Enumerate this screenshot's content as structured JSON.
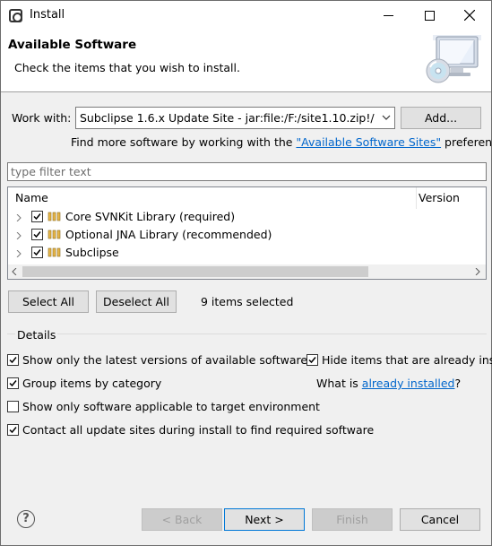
{
  "window": {
    "title": "Install"
  },
  "banner": {
    "title": "Available Software",
    "description": "Check the items that you wish to install."
  },
  "work_with": {
    "label": "Work with:",
    "value": "Subclipse 1.6.x Update Site - jar:file:/F:/site1.10.zip!/",
    "add_label": "Add..."
  },
  "find_more": {
    "prefix": "Find more software by working with the ",
    "link": "\"Available Software Sites\"",
    "suffix": " preferences."
  },
  "filter": {
    "placeholder": "type filter text"
  },
  "tree": {
    "columns": [
      "Name",
      "Version"
    ],
    "items": [
      {
        "label": "Core SVNKit Library (required)",
        "checked": true
      },
      {
        "label": "Optional JNA Library (recommended)",
        "checked": true
      },
      {
        "label": "Subclipse",
        "checked": true
      }
    ]
  },
  "selection": {
    "select_all": "Select All",
    "deselect_all": "Deselect All",
    "count_text": "9 items selected"
  },
  "details": {
    "label": "Details",
    "options": {
      "latest_versions": {
        "label": "Show only the latest versions of available software",
        "checked": true
      },
      "hide_installed": {
        "label": "Hide items that are already insta",
        "checked": true
      },
      "group_by_category": {
        "label": "Group items by category",
        "checked": true
      },
      "target_env": {
        "label": "Show only software applicable to target environment",
        "checked": false
      },
      "contact_sites": {
        "label": "Contact all update sites during install to find required software",
        "checked": true
      }
    },
    "what_is_prefix": "What is ",
    "what_is_link": "already installed",
    "what_is_suffix": "?"
  },
  "footer": {
    "help": "?",
    "back": "< Back",
    "next": "Next >",
    "finish": "Finish",
    "cancel": "Cancel"
  }
}
